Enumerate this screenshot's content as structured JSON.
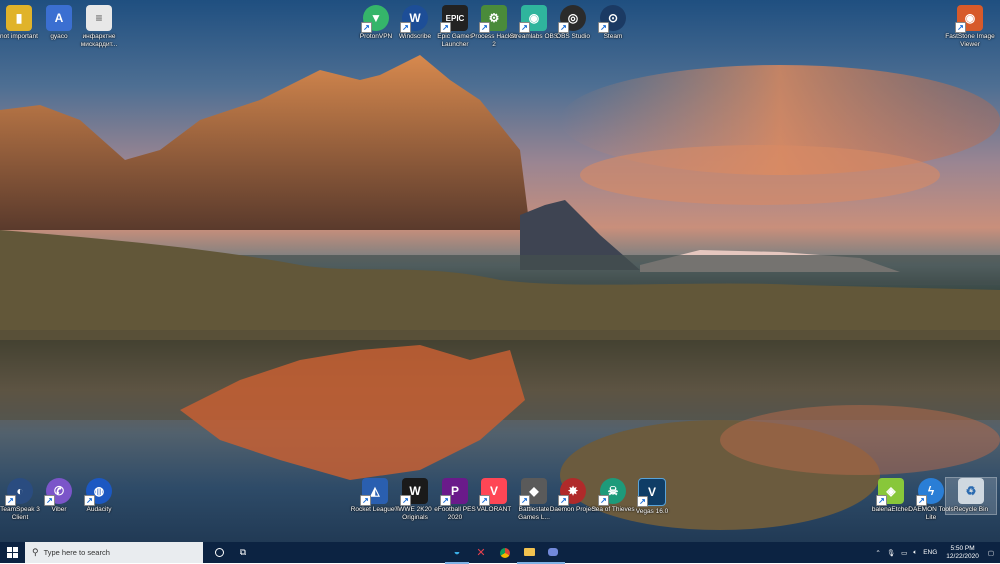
{
  "desktop": {
    "icons": [
      {
        "label": "not important",
        "glyph": "▮",
        "color": "#e0b32a",
        "icon": "folder-icon"
      },
      {
        "label": "gyaco",
        "glyph": "A",
        "color": "#3b6fd1",
        "icon": "document-icon"
      },
      {
        "label": "инфарктне мискардит...",
        "glyph": "≡",
        "color": "#e8e8e8",
        "icon": "text-file-icon"
      },
      {
        "label": "ProtonVPN",
        "glyph": "▼",
        "color": "#35b56a",
        "icon": "protonvpn-icon"
      },
      {
        "label": "Windscribe",
        "glyph": "W",
        "color": "#1d4e97",
        "icon": "windscribe-icon"
      },
      {
        "label": "Epic Games Launcher",
        "glyph": "EPIC",
        "color": "#222222",
        "icon": "epic-games-icon"
      },
      {
        "label": "Process Hacker 2",
        "glyph": "⚙",
        "color": "#4a8b3a",
        "icon": "process-hacker-icon"
      },
      {
        "label": "Streamlabs OBS",
        "glyph": "◉",
        "color": "#2fb59d",
        "icon": "streamlabs-icon"
      },
      {
        "label": "OBS Studio",
        "glyph": "◎",
        "color": "#2b2b2b",
        "icon": "obs-icon"
      },
      {
        "label": "Steam",
        "glyph": "⊙",
        "color": "#1b3a63",
        "icon": "steam-icon"
      },
      {
        "label": "FastStone Image Viewer",
        "glyph": "◉",
        "color": "#d75a2a",
        "icon": "faststone-icon"
      },
      {
        "label": "TeamSpeak 3 Client",
        "glyph": "◐",
        "color": "#2a4c80",
        "icon": "teamspeak-icon"
      },
      {
        "label": "Viber",
        "glyph": "✆",
        "color": "#7b55c9",
        "icon": "viber-icon"
      },
      {
        "label": "Audacity",
        "glyph": "◍",
        "color": "#1c58c2",
        "icon": "audacity-icon"
      },
      {
        "label": "Rocket League®",
        "glyph": "◭",
        "color": "#2a5fb0",
        "icon": "rocket-league-icon"
      },
      {
        "label": "WWE 2K20 Originals",
        "glyph": "W",
        "color": "#1a1a1a",
        "icon": "wwe-icon"
      },
      {
        "label": "eFootball PES 2020",
        "glyph": "P",
        "color": "#6a1a8a",
        "icon": "pes-icon"
      },
      {
        "label": "VALORANT",
        "glyph": "V",
        "color": "#ff4655",
        "icon": "valorant-icon"
      },
      {
        "label": "Battlestate Games L...",
        "glyph": "◆",
        "color": "#5a5a5a",
        "icon": "battlestate-icon"
      },
      {
        "label": "Daemon Project",
        "glyph": "✸",
        "color": "#b02a2a",
        "icon": "daemon-project-icon"
      },
      {
        "label": "Sea of Thieves",
        "glyph": "☠",
        "color": "#1d9a7a",
        "icon": "sea-of-thieves-icon"
      },
      {
        "label": "Vegas 16.0",
        "glyph": "V",
        "color": "#0f3d66",
        "icon": "vegas-icon"
      },
      {
        "label": "balenaEtcher",
        "glyph": "◈",
        "color": "#88c73a",
        "icon": "balenaetcher-icon"
      },
      {
        "label": "DAEMON Tools Lite",
        "glyph": "ϟ",
        "color": "#2a7ed6",
        "icon": "daemon-tools-icon"
      },
      {
        "label": "Recycle Bin",
        "glyph": "♻",
        "color": "#cfd8e0",
        "icon": "recycle-bin-icon"
      }
    ]
  },
  "taskbar": {
    "search_placeholder": "Type here to search",
    "tray": {
      "language": "ENG",
      "time": "5:50 PM",
      "date": "12/22/2020"
    }
  }
}
